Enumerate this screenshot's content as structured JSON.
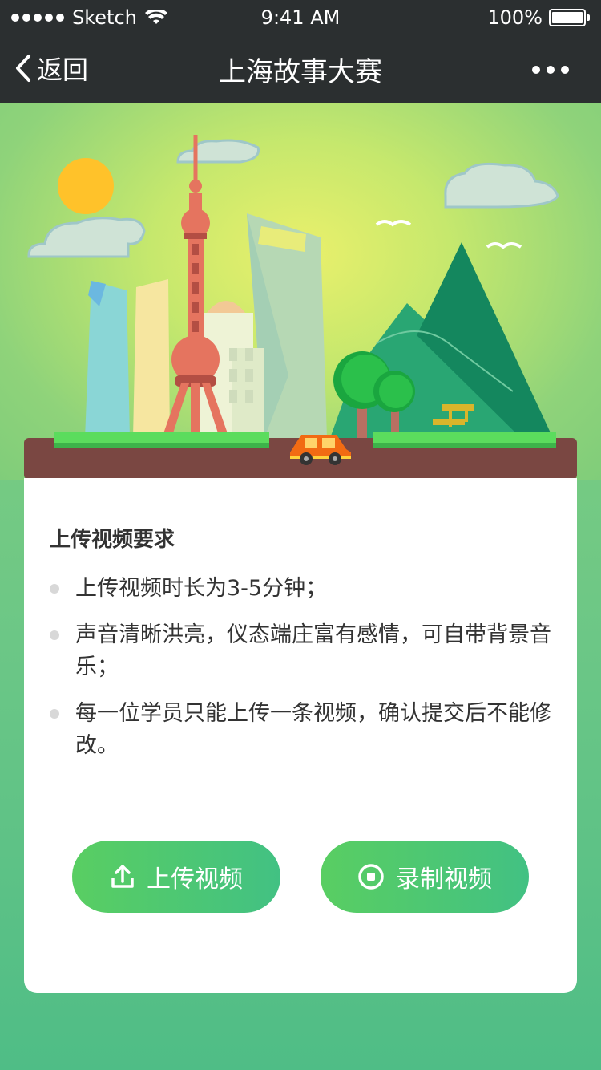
{
  "status": {
    "carrier": "Sketch",
    "time": "9:41 AM",
    "battery": "100%"
  },
  "nav": {
    "back_label": "返回",
    "title": "上海故事大赛"
  },
  "card": {
    "heading": "上传视频要求",
    "requirements": [
      {
        "text": "上传视频时长为3-5分钟；"
      },
      {
        "text": "声音清晰洪亮，仪态端庄富有感情，可自带背景音乐；"
      },
      {
        "text": "每一位学员只能上传一条视频，确认提交后不能修改。"
      }
    ],
    "upload_label": "上传视频",
    "record_label": "录制视频"
  },
  "icons": {
    "back": "chevron-left-icon",
    "more": "more-dots-icon",
    "upload": "upload-icon",
    "record": "record-icon"
  },
  "colors": {
    "nav_bg": "#2b2f30",
    "button_start": "#59ce62",
    "button_end": "#42c183",
    "ground": "#7a4742"
  }
}
